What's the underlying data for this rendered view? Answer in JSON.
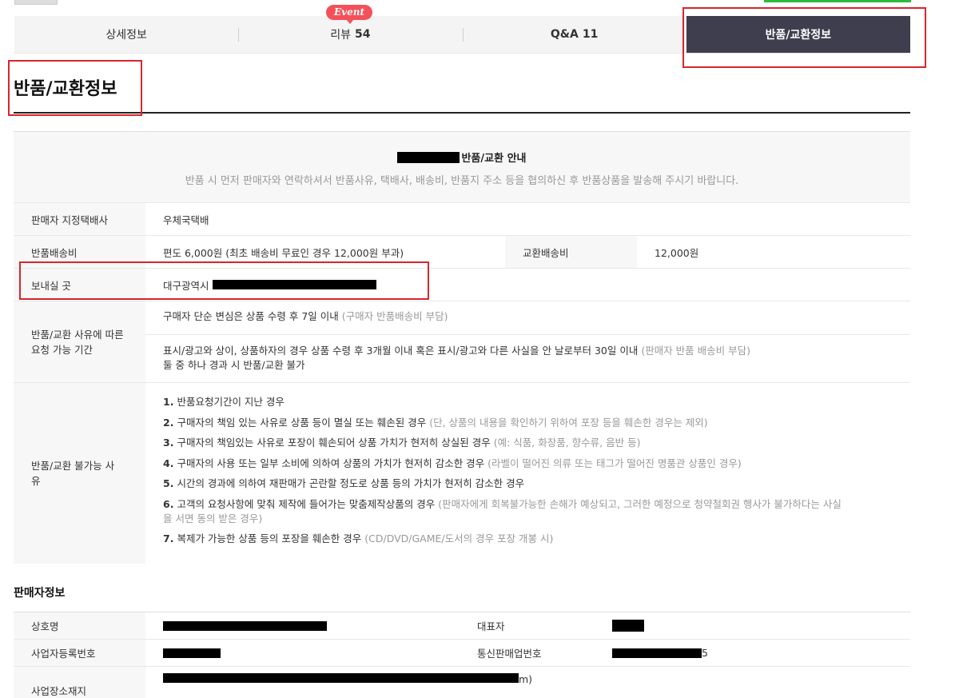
{
  "tabs": [
    {
      "label": "상세정보",
      "count": ""
    },
    {
      "label": "리뷰",
      "count": "54"
    },
    {
      "label": "Q&A",
      "count": "11"
    },
    {
      "label": "반품/교환정보",
      "count": ""
    }
  ],
  "event_badge": "Event",
  "page_title": "반품/교환정보",
  "notice": {
    "title": "반품/교환 안내",
    "desc": "반품 시 먼저 판매자와 연락하셔서 반품사유, 택배사, 배송비, 반품지 주소 등을 협의하신 후 반품상품을 발송해 주시기 바랍니다."
  },
  "carrier": {
    "label": "판매자 지정택배사",
    "value": "우체국택배"
  },
  "shipping": {
    "return_label": "반품배송비",
    "return_value": "편도 6,000원 (최초 배송비 무료인 경우 12,000원 부과)",
    "exchange_label": "교환배송비",
    "exchange_value": "12,000원"
  },
  "address": {
    "label": "보내실 곳",
    "value": "대구광역시"
  },
  "period": {
    "label": "반품/교환 사유에 따른 요청 가능 기간",
    "line1_main": "구매자 단순 변심은 상품 수령 후 7일 이내",
    "line1_note": "(구매자 반품배송비 부담)",
    "line2_main": "표시/광고와 상이, 상품하자의 경우 상품 수령 후 3개월 이내 혹은 표시/광고와 다른 사실을 안 날로부터 30일 이내",
    "line2_note": "(판매자 반품 배송비 부담)",
    "line2_tail": "둘 중 하나 경과 시 반품/교환 불가"
  },
  "not_allowed": {
    "label": "반품/교환 불가능 사유",
    "items": [
      {
        "num": "1.",
        "main": "반품요청기간이 지난 경우",
        "note": ""
      },
      {
        "num": "2.",
        "main": "구매자의 책임 있는 사유로 상품 등이 멸실 또는 훼손된 경우",
        "note": "(단, 상품의 내용을 확인하기 위하여 포장 등을 훼손한 경우는 제외)"
      },
      {
        "num": "3.",
        "main": "구매자의 책임있는 사유로 포장이 훼손되어 상품 가치가 현저히 상실된 경우",
        "note": "(예: 식품, 화장품, 향수류, 음반 등)"
      },
      {
        "num": "4.",
        "main": "구매자의 사용 또는 일부 소비에 의하여 상품의 가치가 현저히 감소한 경우",
        "note": "(라벨이 떨어진 의류 또는 태그가 떨어진 명품관 상품인 경우)"
      },
      {
        "num": "5.",
        "main": "시간의 경과에 의하여 재판매가 곤란할 정도로 상품 등의 가치가 현저히 감소한 경우",
        "note": ""
      },
      {
        "num": "6.",
        "main": "고객의 요청사항에 맞춰 제작에 들어가는 맞춤제작상품의 경우",
        "note": "(판매자에게 회복불가능한 손해가 예상되고, 그러한 예정으로 청약철회권 행사가 불가하다는 사실을 서면 동의 받은 경우)"
      },
      {
        "num": "7.",
        "main": "복제가 가능한 상품 등의 포장을 훼손한 경우",
        "note": "(CD/DVD/GAME/도서의 경우 포장 개봉 시)"
      }
    ]
  },
  "seller": {
    "heading": "판매자정보",
    "company_label": "상호명",
    "ceo_label": "대표자",
    "bizno_label": "사업자등록번호",
    "mailorder_label": "통신판매업번호",
    "mailorder_suffix": "5",
    "addr_label": "사업장소재지",
    "addr_suffix": "m)"
  },
  "colors": {
    "active_tab": "#3e3e4e",
    "badge": "#f4505a",
    "highlight": "#d7262c"
  }
}
